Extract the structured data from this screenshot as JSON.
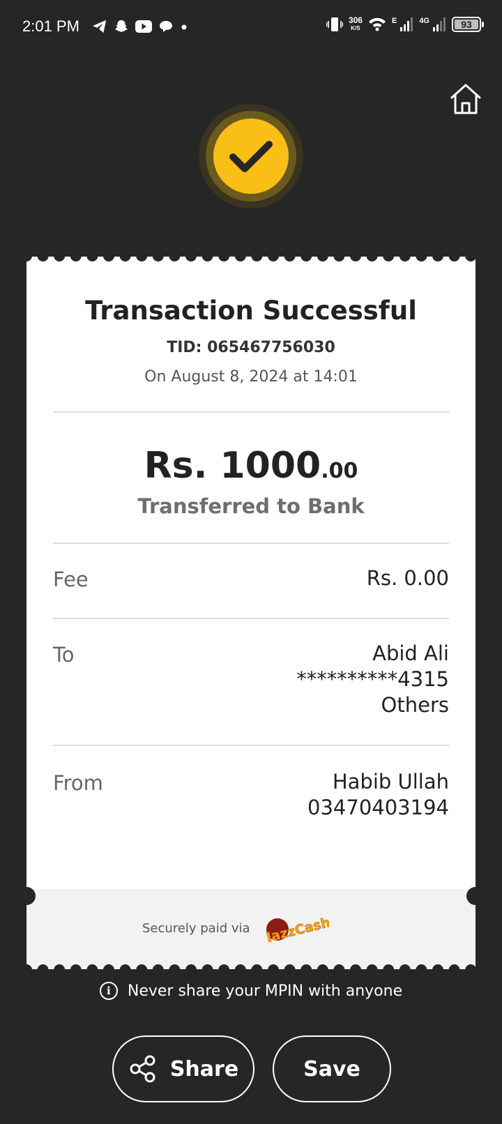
{
  "status_bar": {
    "time": "2:01 PM",
    "app_icons": [
      "telegram-icon",
      "snapchat-icon",
      "youtube-icon",
      "chat-bubble-icon",
      "dot-icon"
    ],
    "net_speed": "306",
    "net_speed_unit": "K/S",
    "network_1": "E",
    "network_2": "4G",
    "battery": "93"
  },
  "colors": {
    "background": "#262626",
    "accent_yellow": "#f9bf16",
    "receipt_bg": "#ffffff"
  },
  "receipt": {
    "title": "Transaction Successful",
    "tid": "TID: 065467756030",
    "date": "On August 8, 2024 at 14:01",
    "amount_main": "Rs. 1000",
    "amount_decimal": ".00",
    "transfer_type": "Transferred to Bank",
    "fee": {
      "label": "Fee",
      "value": "Rs. 0.00"
    },
    "to": {
      "label": "To",
      "name": "Abid Ali",
      "account": "**********4315",
      "bank": "Others"
    },
    "from": {
      "label": "From",
      "name": "Habib Ullah",
      "number": "03470403194"
    },
    "secure_text": "Securely paid via",
    "logo_text": "JazzCash"
  },
  "footer": {
    "mpin_note": "Never share your MPIN with anyone",
    "share_label": "Share",
    "save_label": "Save"
  }
}
